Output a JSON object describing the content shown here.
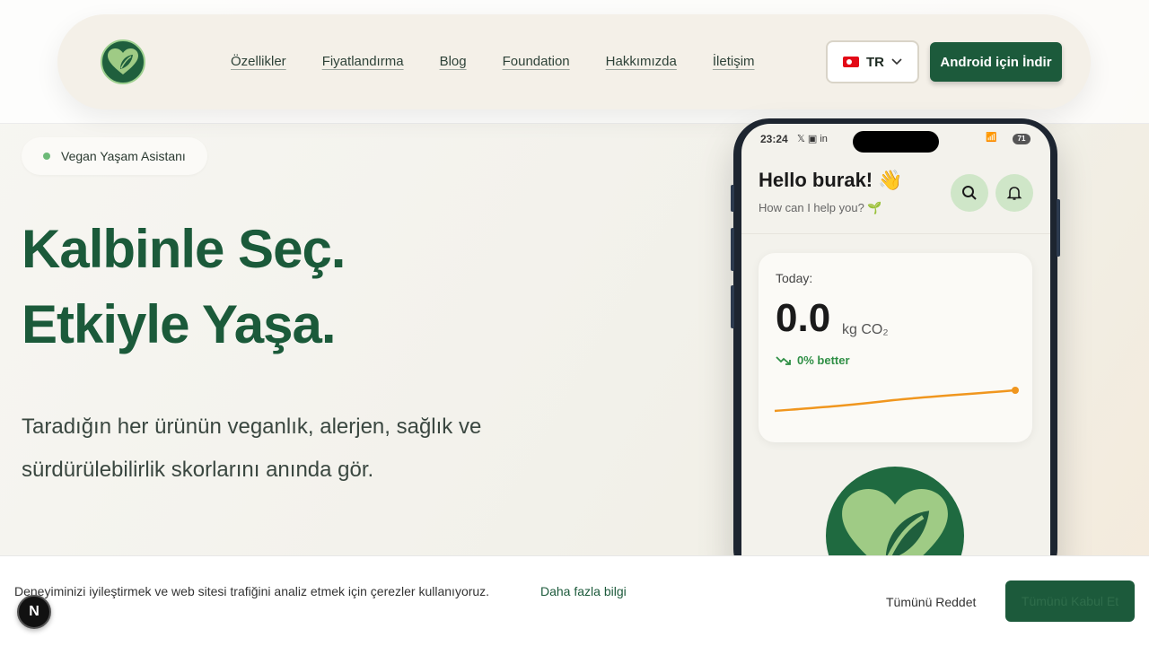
{
  "nav": {
    "logo_icon": "heart-leaf-icon",
    "links": [
      "Özellikler",
      "Fiyatlandırma",
      "Blog",
      "Foundation",
      "Hakkımızda",
      "İletişim"
    ],
    "language": "TR",
    "download_label": "Android için İndir"
  },
  "hero": {
    "badge": "Vegan Yaşam Asistanı",
    "title_line1": "Kalbinle Seç.",
    "title_line2": "Etkiyle Yaşa.",
    "subtitle": "Taradığın her ürünün veganlık, alerjen, sağlık ve sürdürülebilirlik skorlarını anında gör."
  },
  "phone": {
    "status_time": "23:24",
    "status_icons": "𝕏 ▣ in",
    "battery": "71",
    "greeting": "Hello burak! 👋",
    "help_text": "How can I help you? 🌱",
    "card": {
      "label": "Today:",
      "value": "0.0",
      "unit": "kg CO₂",
      "trend": "0% better"
    }
  },
  "cookie": {
    "text": "Deneyiminizi iyileştirmek ve web sitesi trafiğini analiz etmek için çerezler kullanıyoruz.",
    "link": "Daha fazla bilgi",
    "reject": "Tümünü Reddet",
    "accept": "Tümünü Kabul Et"
  },
  "dev_badge": "N",
  "colors": {
    "brand": "#1c5a3b",
    "accent_light": "#cfe6c8",
    "trend_line": "#f0961e"
  }
}
